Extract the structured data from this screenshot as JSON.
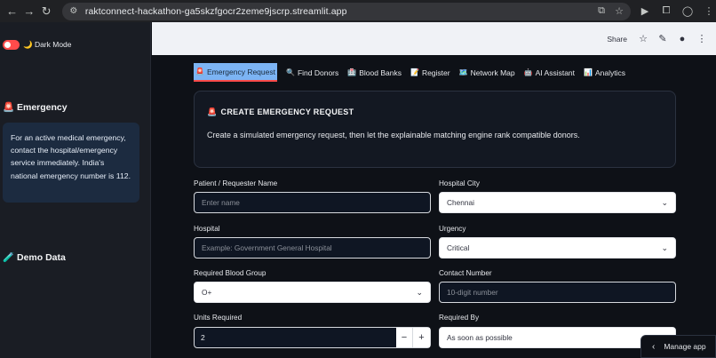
{
  "browser": {
    "url": "raktconnect-hackathon-ga5skzfgocr2zeme9jscrp.streamlit.app"
  },
  "sidebar": {
    "toggle_label": "🌙 Dark Mode",
    "emergency_heading": "🚨 Emergency",
    "emergency_text": "For an active medical emergency, contact the hospital/emergency service immediately. India's national emergency number is 112.",
    "demo_heading": "🧪 Demo Data"
  },
  "header": {
    "share_label": "Share"
  },
  "tabs": [
    {
      "icon": "🚨",
      "label": "Emergency Request"
    },
    {
      "icon": "🔍",
      "label": "Find Donors"
    },
    {
      "icon": "🏥",
      "label": "Blood Banks"
    },
    {
      "icon": "📝",
      "label": "Register"
    },
    {
      "icon": "🗺️",
      "label": "Network Map"
    },
    {
      "icon": "🤖",
      "label": "AI Assistant"
    },
    {
      "icon": "📊",
      "label": "Analytics"
    }
  ],
  "card": {
    "icon": "🚨",
    "title": "CREATE EMERGENCY REQUEST",
    "description": "Create a simulated emergency request, then let the explainable matching engine rank compatible donors."
  },
  "form": {
    "patient_label": "Patient / Requester Name",
    "patient_placeholder": "Enter name",
    "city_label": "Hospital City",
    "city_value": "Chennai",
    "hospital_label": "Hospital",
    "hospital_placeholder": "Example: Government General Hospital",
    "urgency_label": "Urgency",
    "urgency_value": "Critical",
    "blood_group_label": "Required Blood Group",
    "blood_group_value": "O+",
    "contact_label": "Contact Number",
    "contact_placeholder": "10-digit number",
    "units_label": "Units Required",
    "units_value": "2",
    "required_by_label": "Required By",
    "required_by_value": "As soon as possible"
  },
  "manage_app": {
    "label": "Manage app"
  },
  "colors": {
    "accent": "#ff4b4b",
    "active_tab": "#7cb4f4",
    "info_box": "#1c2b40"
  }
}
